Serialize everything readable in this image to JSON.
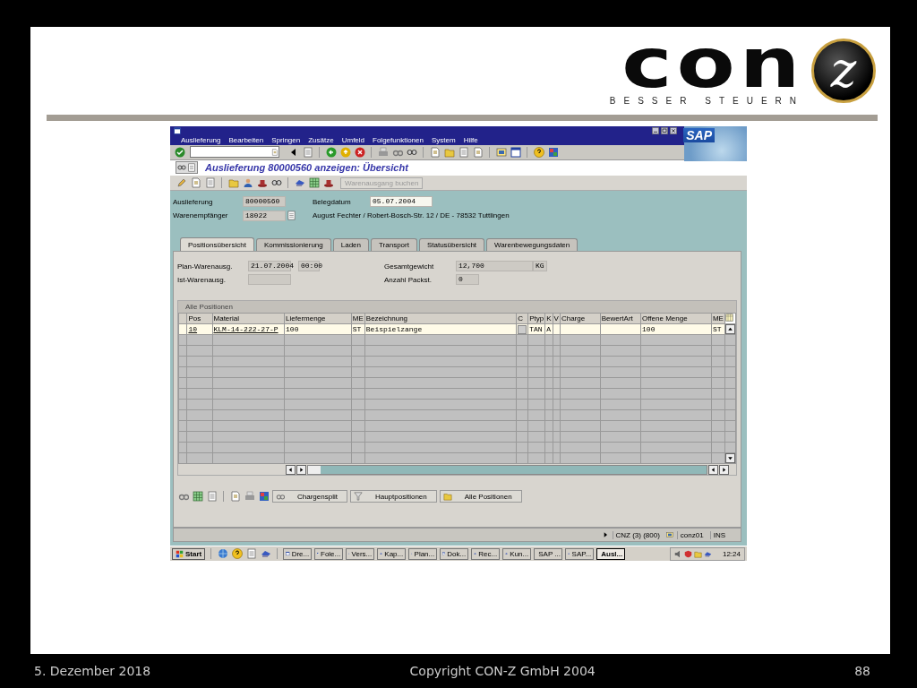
{
  "slide": {
    "logo": {
      "wordmark": "con",
      "emblem": "z",
      "tagline": "BESSER STEUERN"
    }
  },
  "sap": {
    "menu": [
      "Auslieferung",
      "Bearbeiten",
      "Springen",
      "Zusätze",
      "Umfeld",
      "Folgefunktionen",
      "System",
      "Hilfe"
    ],
    "brand": "SAP",
    "title": "Auslieferung 80000560 anzeigen: Übersicht",
    "app_toolbar": {
      "button": {
        "label": "Warenausgang buchen",
        "disabled": true
      }
    },
    "header": {
      "fields": [
        {
          "label": "Auslieferung",
          "value": "80000560"
        },
        {
          "label": "Warenempfänger",
          "value": "18022"
        }
      ],
      "date": {
        "label": "Belegdatum",
        "value": "05.07.2004"
      },
      "partner": "August Fechter / Robert-Bosch-Str. 12 / DE - 78532 Tuttlingen"
    },
    "tabs": [
      {
        "label": "Positionsübersicht",
        "selected": true
      },
      {
        "label": "Kommissionierung",
        "selected": false
      },
      {
        "label": "Laden",
        "selected": false
      },
      {
        "label": "Transport",
        "selected": false
      },
      {
        "label": "Statusübersicht",
        "selected": false
      },
      {
        "label": "Warenbewegungsdaten",
        "selected": false
      }
    ],
    "overview": {
      "left": [
        {
          "label": "Plan-Warenausg.",
          "value": "21.07.2004",
          "time": "00:00"
        },
        {
          "label": "Ist-Warenausg."
        }
      ],
      "right": [
        {
          "label": "Gesamtgewicht",
          "value": "12,700",
          "unit": "KG"
        },
        {
          "label": "Anzahl Packst.",
          "value": "0"
        }
      ]
    },
    "table": {
      "title": "Alle Positionen",
      "columns": [
        {
          "label": "Pos",
          "kind": "link"
        },
        {
          "label": "Material",
          "kind": "link"
        },
        {
          "label": "Liefermenge",
          "kind": "text"
        },
        {
          "label": "ME",
          "kind": "text"
        },
        {
          "label": "Bezeichnung",
          "kind": "text"
        },
        {
          "label": "C",
          "kind": "button"
        },
        {
          "label": "Ptyp",
          "kind": "text"
        },
        {
          "label": "K",
          "kind": "text"
        },
        {
          "label": "V",
          "kind": "text"
        },
        {
          "label": "Charge",
          "kind": "text"
        },
        {
          "label": "BewertArt",
          "kind": "text"
        },
        {
          "label": "Offene Menge",
          "kind": "text"
        },
        {
          "label": "ME",
          "kind": "text"
        }
      ],
      "rows": [
        [
          "10",
          "KLM-14-222-27-P",
          "100",
          "ST",
          "Beispielzange",
          null,
          "TAN",
          "A",
          null,
          null,
          null,
          "100",
          "ST"
        ]
      ]
    },
    "buttons": [
      "Chargensplit",
      "Hauptpositionen",
      "Alle Positionen"
    ],
    "status_bar": {
      "system": "CNZ (3) (800)",
      "user": "conz01",
      "mode": "INS"
    }
  },
  "taskbar": {
    "start": "Start",
    "items": [
      {
        "label": "Dre...",
        "selected": false
      },
      {
        "label": "Fole...",
        "selected": false
      },
      {
        "label": "Vers...",
        "selected": false
      },
      {
        "label": "Kap...",
        "selected": false
      },
      {
        "label": "Plan...",
        "selected": false
      },
      {
        "label": "Dok...",
        "selected": false
      },
      {
        "label": "Rec...",
        "selected": false
      },
      {
        "label": "Kun...",
        "selected": false
      },
      {
        "label": "SAP ...",
        "selected": false
      },
      {
        "label": "SAP...",
        "selected": false
      },
      {
        "label": "Ausl...",
        "selected": true
      }
    ],
    "clock": "12:24"
  },
  "footer": {
    "date": "5. Dezember 2018",
    "copyright": "Copyright CON-Z GmbH 2004",
    "page": "88"
  }
}
